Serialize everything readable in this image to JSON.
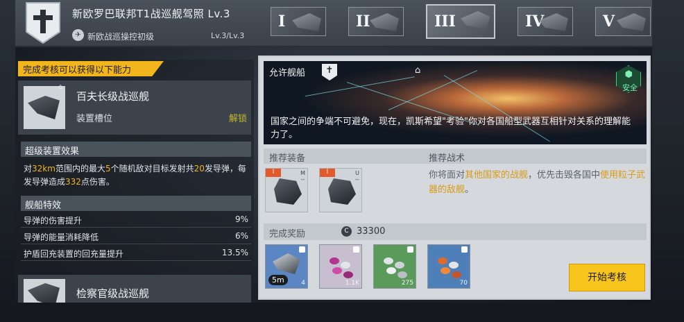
{
  "header": {
    "title": "新欧罗巴联邦T1战巡舰驾照 Lv.3",
    "badge_glyph": "✝",
    "sub_label": "新欧战巡操控初级",
    "level": "Lv.3/Lv.3",
    "tiers": [
      "I",
      "II",
      "III",
      "IV",
      "V"
    ],
    "active_tier": "III"
  },
  "left": {
    "banner": "完成考核可以获得以下能力",
    "unlock_card": {
      "name": "百夫长级战巡舰",
      "slot": "装置槽位",
      "status": "解锁"
    },
    "super_effect": {
      "title": "超级装置效果",
      "desc_parts": [
        "对",
        "32km",
        "范围内的最大",
        "5",
        "个随机敌对目标发射共",
        "20",
        "发导弹，每发导弹造成",
        "332",
        "点伤害。"
      ]
    },
    "ship_effects": {
      "title": "舰船特效",
      "rows": [
        {
          "label": "导弹的伤害提升",
          "value": "9%"
        },
        {
          "label": "导弹的能量消耗降低",
          "value": "6%"
        },
        {
          "label": "护盾回充装置的回充量提升",
          "value": "13.5%"
        }
      ]
    },
    "next_card": {
      "name": "检察官级战巡舰"
    }
  },
  "right": {
    "allowed_ships_label": "允许舰船",
    "safe_label": "安全",
    "description": "国家之间的争端不可避免，现在，凯斯希望\"考验\"你对各国船型武器互相针对关系的理解能力了。",
    "recommended_equipment_label": "推荐装备",
    "recommended_tactics_label": "推荐战术",
    "equipment": [
      {
        "tag": "I",
        "corner": "M\n--"
      },
      {
        "tag": "I",
        "corner": "U\n--"
      }
    ],
    "tactic_parts": [
      "你将面对",
      "其他国家的战舰",
      "，优先击毁各国中",
      "使用粒子武器的敌舰",
      "。"
    ],
    "reward_label": "完成奖励",
    "coin_icon": "C",
    "coin_amount": "33300",
    "rewards": [
      {
        "qty": "4",
        "badge": "5m",
        "color": "#5a87c4"
      },
      {
        "qty": "1.1K",
        "color": "#c7bfcf"
      },
      {
        "qty": "275",
        "color": "#5a9a5a"
      },
      {
        "qty": "70",
        "color": "#4f7fb8"
      }
    ],
    "start_button": "开始考核"
  }
}
